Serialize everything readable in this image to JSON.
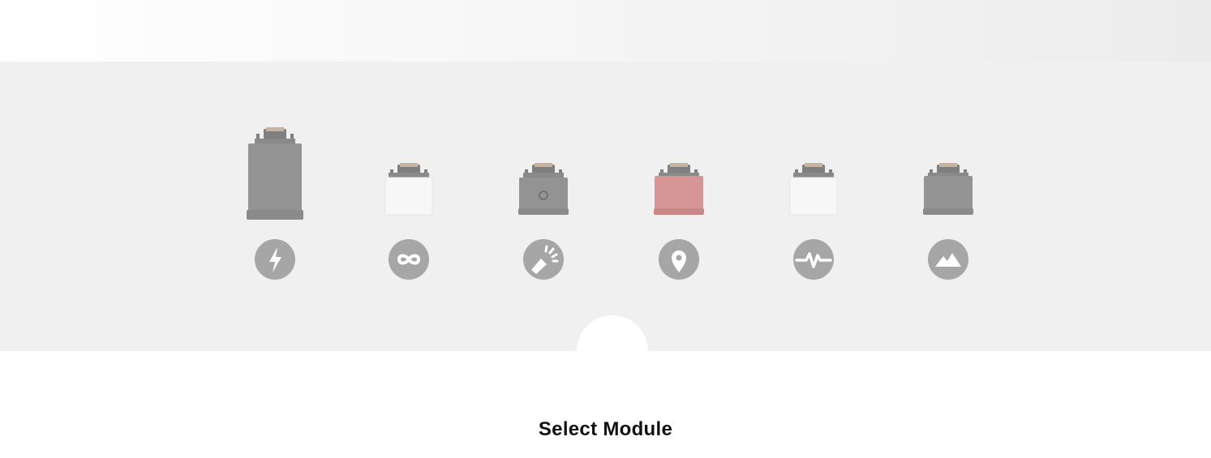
{
  "header": {
    "title": "Select Module"
  },
  "modules": [
    {
      "id": "power",
      "icon": "lightning-bolt-icon",
      "body_color": "#939393",
      "size": "tall"
    },
    {
      "id": "infinity",
      "icon": "infinity-icon",
      "body_color": "#f7f7f7",
      "size": "small"
    },
    {
      "id": "flashlight",
      "icon": "flashlight-icon",
      "body_color": "#939393",
      "size": "small"
    },
    {
      "id": "location",
      "icon": "map-pin-icon",
      "body_color": "#d69696",
      "size": "small"
    },
    {
      "id": "heart-rate",
      "icon": "pulse-icon",
      "body_color": "#f7f7f7",
      "size": "small"
    },
    {
      "id": "terrain",
      "icon": "mountain-icon",
      "body_color": "#939393",
      "size": "small"
    }
  ],
  "colors": {
    "icon_circle": "#a6a6a6",
    "band": "#f0f0f0",
    "connector": "#7f7f7f"
  }
}
